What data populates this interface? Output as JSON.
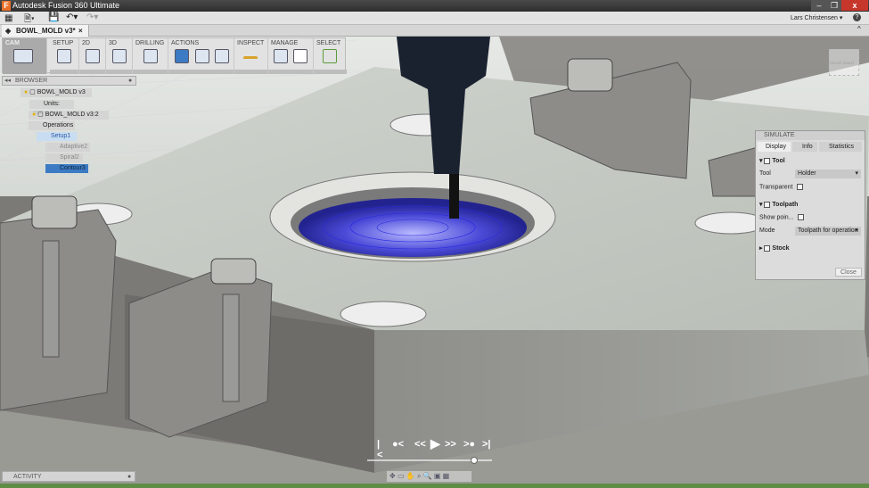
{
  "titlebar": {
    "app_title": "Autodesk Fusion 360 Ultimate",
    "window_controls": [
      "minimize",
      "restore",
      "close"
    ]
  },
  "toolbar": {
    "user": "Lars Christensen ▾",
    "help": "?"
  },
  "document_tab": {
    "label": "BOWL_MOLD v3*",
    "close": "×"
  },
  "ribbon": {
    "workspace": "CAM",
    "groups": [
      "SETUP",
      "2D",
      "3D",
      "DRILLING",
      "ACTIONS",
      "INSPECT",
      "MANAGE",
      "SELECT"
    ]
  },
  "browser": {
    "title": "BROWSER",
    "items": [
      {
        "label": "BOWL_MOLD v3",
        "level": 0
      },
      {
        "label": "Units: mm",
        "level": 1
      },
      {
        "label": "BOWL_MOLD v3:2",
        "level": 1
      },
      {
        "label": "Operations",
        "level": 1
      },
      {
        "label": "Setup1",
        "level": 2
      },
      {
        "label": "Adaptive2",
        "level": 3
      },
      {
        "label": "Spiral2",
        "level": 3
      },
      {
        "label": "Contour3",
        "level": 3,
        "selected": true
      }
    ]
  },
  "simulate": {
    "title": "SIMULATE",
    "tabs": [
      "Display",
      "Info",
      "Statistics"
    ],
    "tool_section": "Tool",
    "tool_label": "Tool",
    "tool_value": "Holder",
    "transparent_label": "Transparent",
    "toolpath_section": "Toolpath",
    "show_points_label": "Show poin...",
    "mode_label": "Mode",
    "mode_value": "Toolpath for operation",
    "stock_section": "Stock",
    "close": "Close"
  },
  "viewcube": {
    "front": "FRONT",
    "right": "RIGHT"
  },
  "activity": {
    "label": "ACTIVITY"
  },
  "playback": {
    "progress": 0.5
  },
  "colors": {
    "accent": "#3c7bc4",
    "status_bar": "#5f8d45",
    "toolpath": "#2a2ae0"
  }
}
